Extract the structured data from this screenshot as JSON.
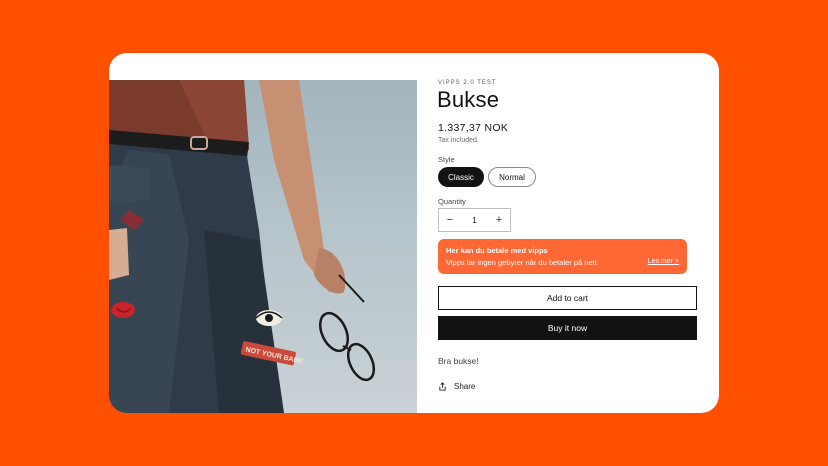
{
  "product": {
    "vendor": "VIPPS 2.0 TEST",
    "title": "Bukse",
    "price": "1.337,37 NOK",
    "tax_note": "Tax included.",
    "style_label": "Style",
    "style_options": [
      "Classic",
      "Normal"
    ],
    "selected_style": "Classic",
    "quantity_label": "Quantity",
    "quantity_value": "1",
    "quantity_decrease": "−",
    "quantity_increase": "+",
    "description": "Bra bukse!",
    "share_label": "Share"
  },
  "vipps_banner": {
    "heading": "Her kan du betale med",
    "brand": "vipps",
    "subtext": "Vipps tar ingen gebyrer når du betaler på nett",
    "link": "Les mer >"
  },
  "buttons": {
    "add_to_cart": "Add to cart",
    "buy_now": "Buy it now"
  },
  "image": {
    "patch_text": "NOT YOUR BABE",
    "icon": "product-photo"
  },
  "colors": {
    "background": "#ff4f00",
    "vipps_orange": "#ff5b24",
    "primary_dark": "#121212"
  }
}
